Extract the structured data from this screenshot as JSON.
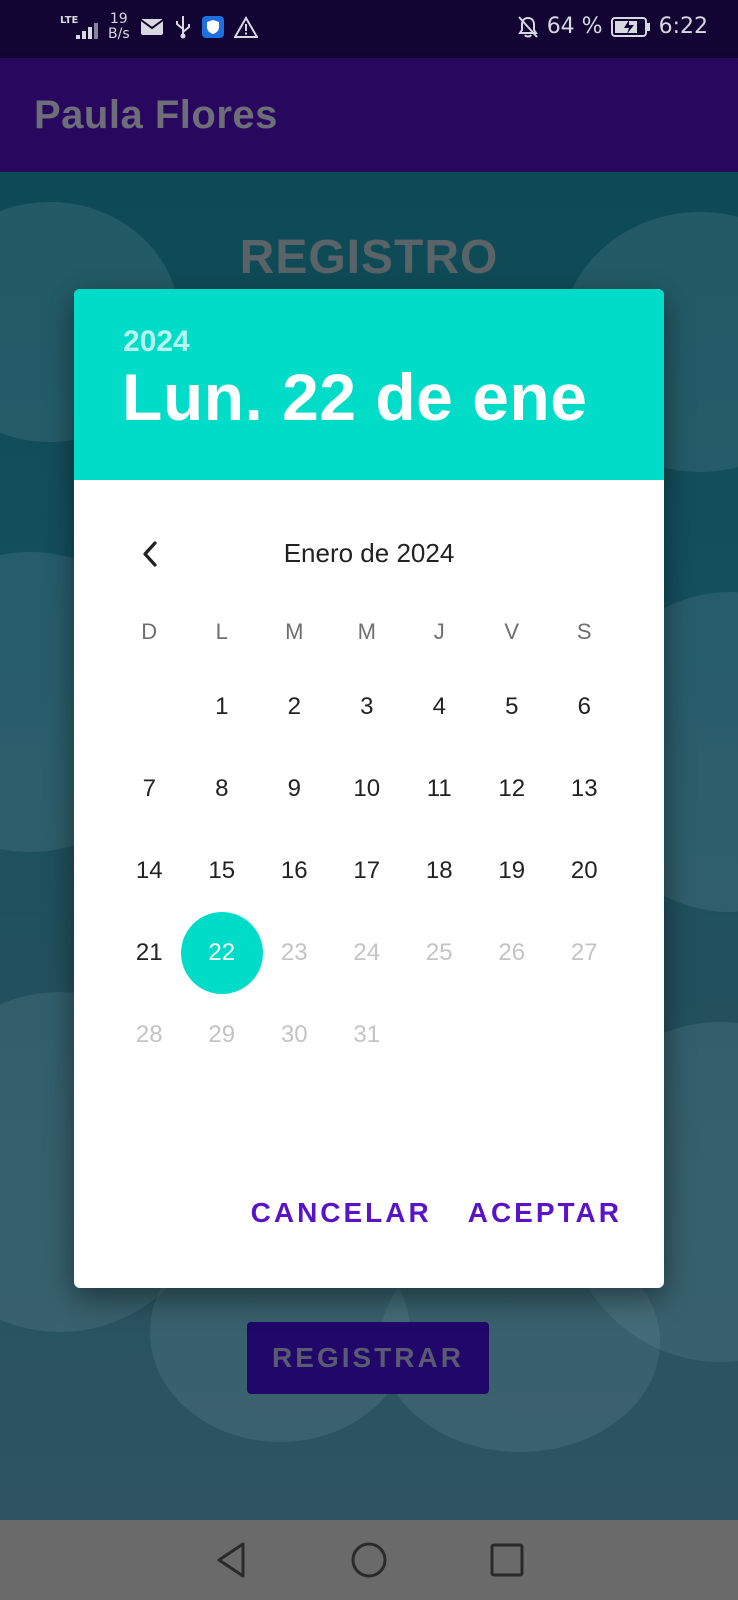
{
  "status_bar": {
    "network": "LTE",
    "speed_value": "19",
    "speed_unit": "B/s",
    "battery": "64 %",
    "time": "6:22"
  },
  "app_bar": {
    "title": "Paula Flores"
  },
  "page": {
    "title": "REGISTRO",
    "submit_label": "REGISTRAR"
  },
  "date_picker": {
    "year": "2024",
    "selected_date": "Lun. 22 de ene",
    "month_label": "Enero de 2024",
    "weekdays": [
      "D",
      "L",
      "M",
      "M",
      "J",
      "V",
      "S"
    ],
    "weeks": [
      [
        "",
        "1",
        "2",
        "3",
        "4",
        "5",
        "6"
      ],
      [
        "7",
        "8",
        "9",
        "10",
        "11",
        "12",
        "13"
      ],
      [
        "14",
        "15",
        "16",
        "17",
        "18",
        "19",
        "20"
      ],
      [
        "21",
        "22",
        "23",
        "24",
        "25",
        "26",
        "27"
      ],
      [
        "28",
        "29",
        "30",
        "31",
        "",
        "",
        ""
      ]
    ],
    "selected_day": "22",
    "cancel_label": "CANCELAR",
    "accept_label": "ACEPTAR",
    "accent_color": "#00dcc8",
    "action_color": "#5a14c8"
  }
}
